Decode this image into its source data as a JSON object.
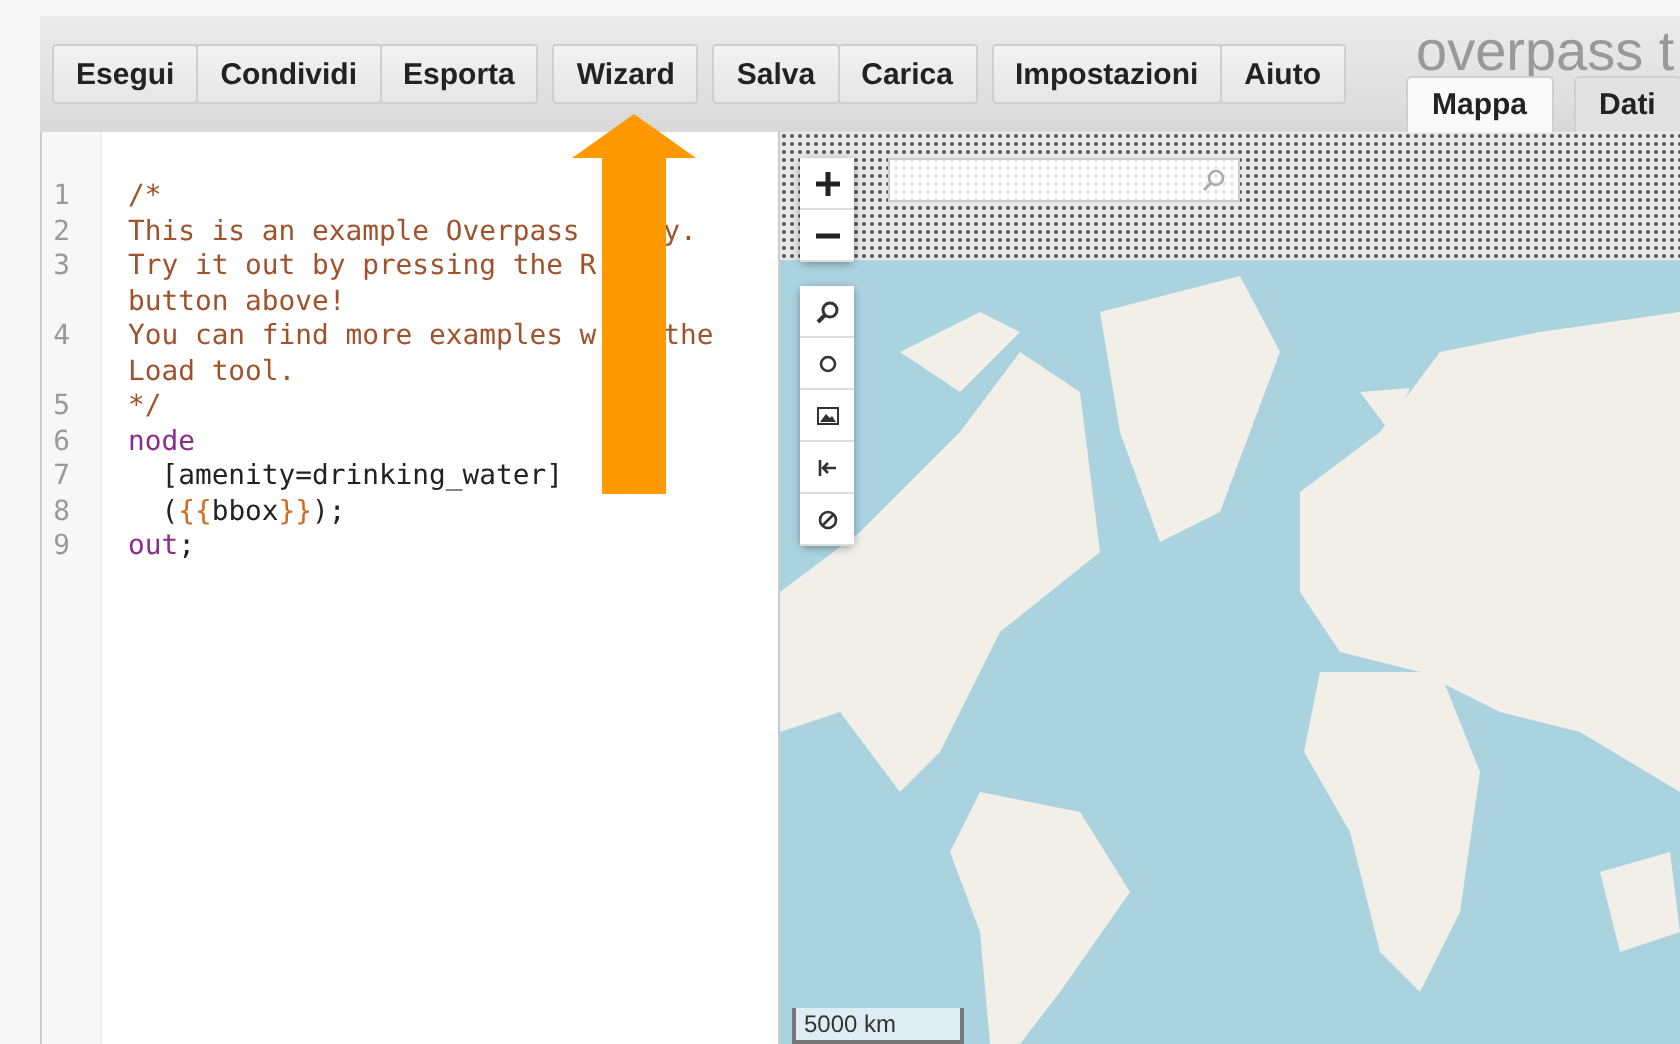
{
  "toolbar": {
    "groups": [
      [
        "Esegui",
        "Condividi",
        "Esporta"
      ],
      [
        "Wizard"
      ],
      [
        "Salva",
        "Carica"
      ],
      [
        "Impostazioni",
        "Aiuto"
      ]
    ]
  },
  "title": "overpass t",
  "tabs": [
    {
      "label": "Mappa",
      "selected": true
    },
    {
      "label": "Dati",
      "selected": false
    }
  ],
  "editor": {
    "lines": [
      {
        "number": "1",
        "segments": [
          {
            "text": "/*",
            "kind": "comment"
          }
        ]
      },
      {
        "number": "2",
        "segments": [
          {
            "text": "This is an example Overpass",
            "kind": "comment"
          },
          {
            "kind": "covered"
          },
          {
            "text": "y.",
            "kind": "comment"
          }
        ]
      },
      {
        "number": "3",
        "segments": [
          {
            "text": "Try it out by pressing the R",
            "kind": "comment"
          },
          {
            "kind": "break"
          },
          {
            "text": "button above!",
            "kind": "comment"
          }
        ]
      },
      {
        "number": "4",
        "segments": [
          {
            "text": "You can find more examples w",
            "kind": "comment"
          },
          {
            "kind": "covered"
          },
          {
            "text": "the",
            "kind": "comment"
          },
          {
            "kind": "break"
          },
          {
            "text": "Load tool.",
            "kind": "comment"
          }
        ]
      },
      {
        "number": "5",
        "segments": [
          {
            "text": "*/",
            "kind": "comment"
          }
        ]
      },
      {
        "number": "6",
        "segments": [
          {
            "text": "node",
            "kind": "keyword"
          }
        ]
      },
      {
        "number": "7",
        "segments": [
          {
            "text": "  [amenity=drinking_water]",
            "kind": "plain"
          }
        ]
      },
      {
        "number": "8",
        "segments": [
          {
            "text": "  (",
            "kind": "plain"
          },
          {
            "text": "{{",
            "kind": "brace"
          },
          {
            "text": "bbox",
            "kind": "plain"
          },
          {
            "text": "}}",
            "kind": "brace"
          },
          {
            "text": ");",
            "kind": "plain"
          }
        ]
      },
      {
        "number": "9",
        "segments": [
          {
            "text": "out",
            "kind": "keyword"
          },
          {
            "text": ";",
            "kind": "plain"
          }
        ]
      }
    ]
  },
  "map": {
    "scale": "5000 km"
  }
}
